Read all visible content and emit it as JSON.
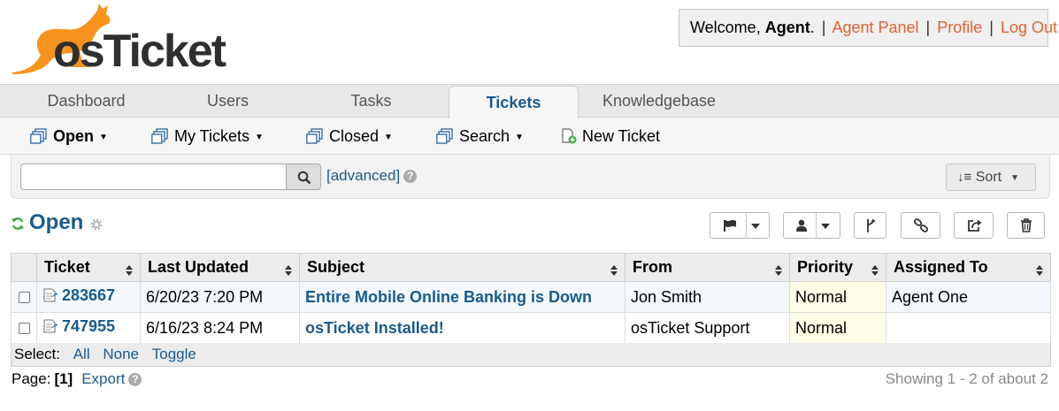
{
  "logo": {
    "text": "osTicket"
  },
  "user_panel": {
    "welcome_prefix": "Welcome, ",
    "user_name": "Agent",
    "welcome_suffix": ".",
    "sep": "|",
    "links": [
      "Agent Panel",
      "Profile",
      "Log Out"
    ]
  },
  "nav": {
    "tabs": [
      "Dashboard",
      "Users",
      "Tasks",
      "Tickets",
      "Knowledgebase"
    ],
    "active": "Tickets"
  },
  "subnav": {
    "open": "Open",
    "my_tickets": "My Tickets",
    "closed": "Closed",
    "search": "Search",
    "new_ticket": "New Ticket"
  },
  "search": {
    "value": "",
    "placeholder": "",
    "advanced_label": "[advanced]",
    "help": "?",
    "sort_label": "Sort"
  },
  "queue": {
    "title": "Open"
  },
  "table": {
    "columns": [
      "Ticket",
      "Last Updated",
      "Subject",
      "From",
      "Priority",
      "Assigned To"
    ],
    "rows": [
      {
        "number": "283667",
        "updated": "6/20/23 7:20 PM",
        "subject": "Entire Mobile Online Banking is Down",
        "from": "Jon Smith",
        "priority": "Normal",
        "assigned": "Agent One"
      },
      {
        "number": "747955",
        "updated": "6/16/23 8:24 PM",
        "subject": "osTicket Installed!",
        "from": "osTicket Support",
        "priority": "Normal",
        "assigned": ""
      }
    ]
  },
  "select_bar": {
    "label": "Select:",
    "all": "All",
    "none": "None",
    "toggle": "Toggle"
  },
  "pagination": {
    "label": "Page:",
    "current": "[1]",
    "export": "Export",
    "help": "?"
  },
  "showing": "Showing 1 - 2 of about 2",
  "colors": {
    "accent": "#1b5a8e",
    "link_orange": "#e1622f",
    "logo_orange": "#f7941d",
    "logo_dark": "#2f2f2f"
  }
}
